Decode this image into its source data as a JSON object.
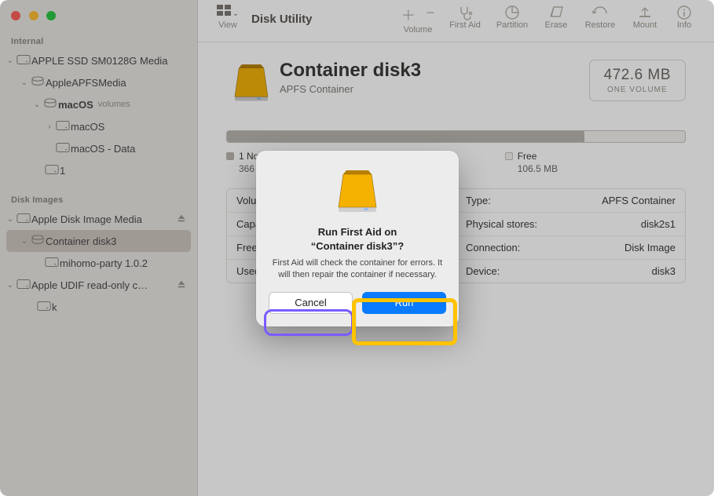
{
  "window": {
    "app_title": "Disk Utility"
  },
  "toolbar": {
    "view_label": "View",
    "items": [
      {
        "label": "Volume"
      },
      {
        "label": "First Aid"
      },
      {
        "label": "Partition"
      },
      {
        "label": "Erase"
      },
      {
        "label": "Restore"
      },
      {
        "label": "Mount"
      },
      {
        "label": "Info"
      }
    ]
  },
  "sidebar": {
    "sections": {
      "internal": {
        "heading": "Internal",
        "root": {
          "label": "APPLE SSD SM0128G Media"
        },
        "apfs": {
          "label": "AppleAPFSMedia"
        },
        "macos_container": {
          "label": "macOS",
          "caption": "volumes"
        },
        "vol_macos": {
          "label": "macOS"
        },
        "vol_macos_data": {
          "label": "macOS - Data"
        },
        "vol_1": {
          "label": "1"
        }
      },
      "images": {
        "heading": "Disk Images",
        "apple_dmg": {
          "label": "Apple Disk Image Media"
        },
        "container3": {
          "label": "Container disk3"
        },
        "mihomo": {
          "label": "mihomo-party 1.0.2"
        },
        "udif": {
          "label": "Apple UDIF read-only c…"
        },
        "k": {
          "label": "k"
        }
      }
    }
  },
  "header": {
    "title": "Container disk3",
    "subtitle": "APFS Container",
    "capacity_value": "472.6 MB",
    "capacity_caption": "ONE VOLUME"
  },
  "usage": {
    "used_pct": 78,
    "not_mounted": {
      "label": "1 Not Mounted",
      "value": "366",
      "color": "#b9b4ad"
    },
    "free": {
      "label": "Free",
      "value": "106.5 MB",
      "color": "#f3f1ed"
    }
  },
  "props": {
    "rows": [
      {
        "k1": "Volume",
        "v1": "",
        "k2": "Type:",
        "v2": "APFS Container"
      },
      {
        "k1": "Capacity",
        "v1": "",
        "k2": "Physical stores:",
        "v2": "disk2s1"
      },
      {
        "k1": "Free:",
        "v1": "",
        "k2": "Connection:",
        "v2": "Disk Image"
      },
      {
        "k1": "Used:",
        "v1": "",
        "k2": "Device:",
        "v2": "disk3"
      }
    ]
  },
  "modal": {
    "title_line1": "Run First Aid on",
    "title_line2": "“Container disk3”?",
    "body": "First Aid will check the container for errors. It will then repair the container if necessary.",
    "cancel": "Cancel",
    "run": "Run"
  }
}
